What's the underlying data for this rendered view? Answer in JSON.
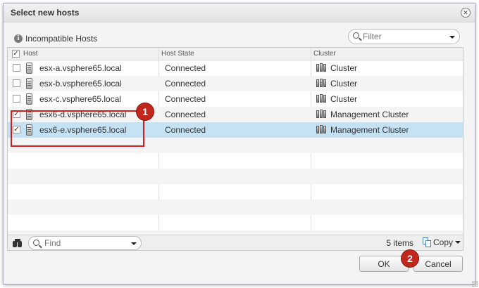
{
  "dialog": {
    "title": "Select new hosts"
  },
  "toolbar": {
    "incompatible_label": "Incompatible Hosts",
    "filter_placeholder": "Filter"
  },
  "table": {
    "columns": [
      "Host",
      "Host State",
      "Cluster"
    ],
    "rows": [
      {
        "host": "esx-a.vsphere65.local",
        "state": "Connected",
        "cluster": "Cluster",
        "checked": false,
        "selected": false
      },
      {
        "host": "esx-b.vsphere65.local",
        "state": "Connected",
        "cluster": "Cluster",
        "checked": false,
        "selected": false
      },
      {
        "host": "esx-c.vsphere65.local",
        "state": "Connected",
        "cluster": "Cluster",
        "checked": false,
        "selected": false
      },
      {
        "host": "esx6-d.vsphere65.local",
        "state": "Connected",
        "cluster": "Management Cluster",
        "checked": true,
        "selected": false
      },
      {
        "host": "esx6-e.vsphere65.local",
        "state": "Connected",
        "cluster": "Management Cluster",
        "checked": true,
        "selected": true
      }
    ],
    "empty_rows": 7
  },
  "footer": {
    "find_placeholder": "Find",
    "item_count": "5 items",
    "copy_label": "Copy"
  },
  "buttons": {
    "ok": "OK",
    "cancel": "Cancel"
  },
  "callouts": {
    "one": "1",
    "two": "2"
  },
  "colors": {
    "selected_row": "#c5e2f4",
    "callout": "#c0281e"
  }
}
